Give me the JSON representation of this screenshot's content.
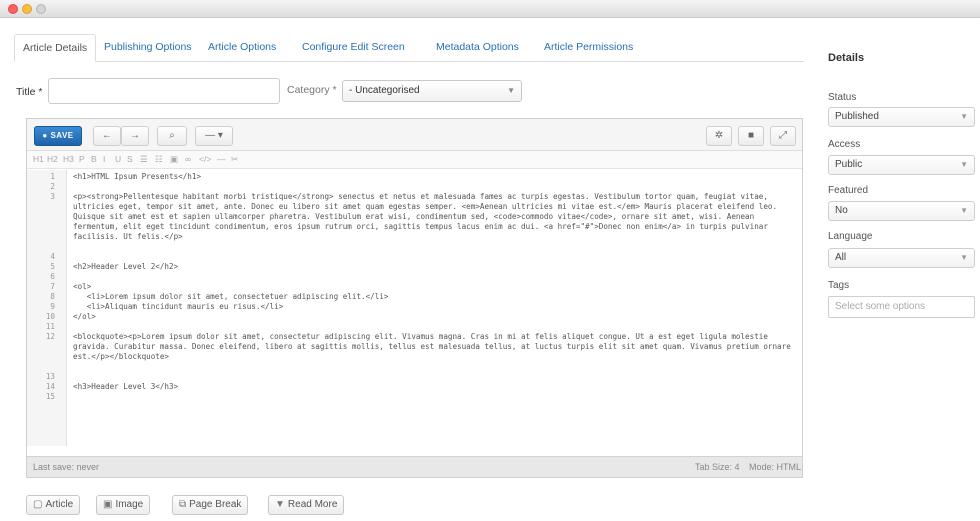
{
  "tabs": [
    {
      "label": "Article Details"
    },
    {
      "label": "Publishing Options"
    },
    {
      "label": "Article Options"
    },
    {
      "label": "Configure Edit Screen"
    },
    {
      "label": "Metadata Options"
    },
    {
      "label": "Article Permissions"
    }
  ],
  "form": {
    "title_label": "Title *",
    "title_value": "",
    "category_label": "Category *",
    "category_value": "- Uncategorised"
  },
  "editor": {
    "save_label": "SAVE",
    "line_numbers": [
      "1",
      "2",
      "3",
      "4",
      "5",
      "6",
      "7",
      "8",
      "9",
      "10",
      "11",
      "12",
      "13",
      "14",
      "15"
    ],
    "lines": [
      "<h1>HTML Ipsum Presents</h1>",
      "",
      "<p><strong>Pellentesque habitant morbi tristique</strong> senectus et netus et malesuada fames ac turpis egestas. Vestibulum tortor quam, feugiat vitae, ultricies eget, tempor sit amet, ante. Donec eu libero sit amet quam egestas semper. <em>Aenean ultricies mi vitae est.</em> Mauris placerat eleifend leo. Quisque sit amet est et sapien ullamcorper pharetra. Vestibulum erat wisi, condimentum sed, <code>commodo vitae</code>, ornare sit amet, wisi. Aenean fermentum, elit eget tincidunt condimentum, eros ipsum rutrum orci, sagittis tempus lacus enim ac dui. <a href=\"#\">Donec non enim</a> in turpis pulvinar facilisis. Ut felis.</p>",
      "",
      "<h2>Header Level 2</h2>",
      "",
      "<ol>",
      "   <li>Lorem ipsum dolor sit amet, consectetuer adipiscing elit.</li>",
      "   <li>Aliquam tincidunt mauris eu risus.</li>",
      "</ol>",
      "",
      "<blockquote><p>Lorem ipsum dolor sit amet, consectetur adipiscing elit. Vivamus magna. Cras in mi at felis aliquet congue. Ut a est eget ligula molestie gravida. Curabitur massa. Donec eleifend, libero at sagittis mollis, tellus est malesuada tellus, at luctus turpis elit sit amet quam. Vivamus pretium ornare est.</p></blockquote>",
      "",
      "<h3>Header Level 3</h3>",
      ""
    ],
    "status_left": "Last save: never",
    "tab_size": "Tab Size: 4",
    "mode": "Mode: HTML"
  },
  "buttons": {
    "article": "Article",
    "image": "Image",
    "pagebreak": "Page Break",
    "readmore": "Read More"
  },
  "details": {
    "title": "Details",
    "status_label": "Status",
    "status_value": "Published",
    "access_label": "Access",
    "access_value": "Public",
    "featured_label": "Featured",
    "featured_value": "No",
    "language_label": "Language",
    "language_value": "All",
    "tags_label": "Tags",
    "tags_placeholder": "Select some options"
  },
  "colors": {
    "link": "#2a6fb5",
    "save_button": "#2a78c4"
  }
}
